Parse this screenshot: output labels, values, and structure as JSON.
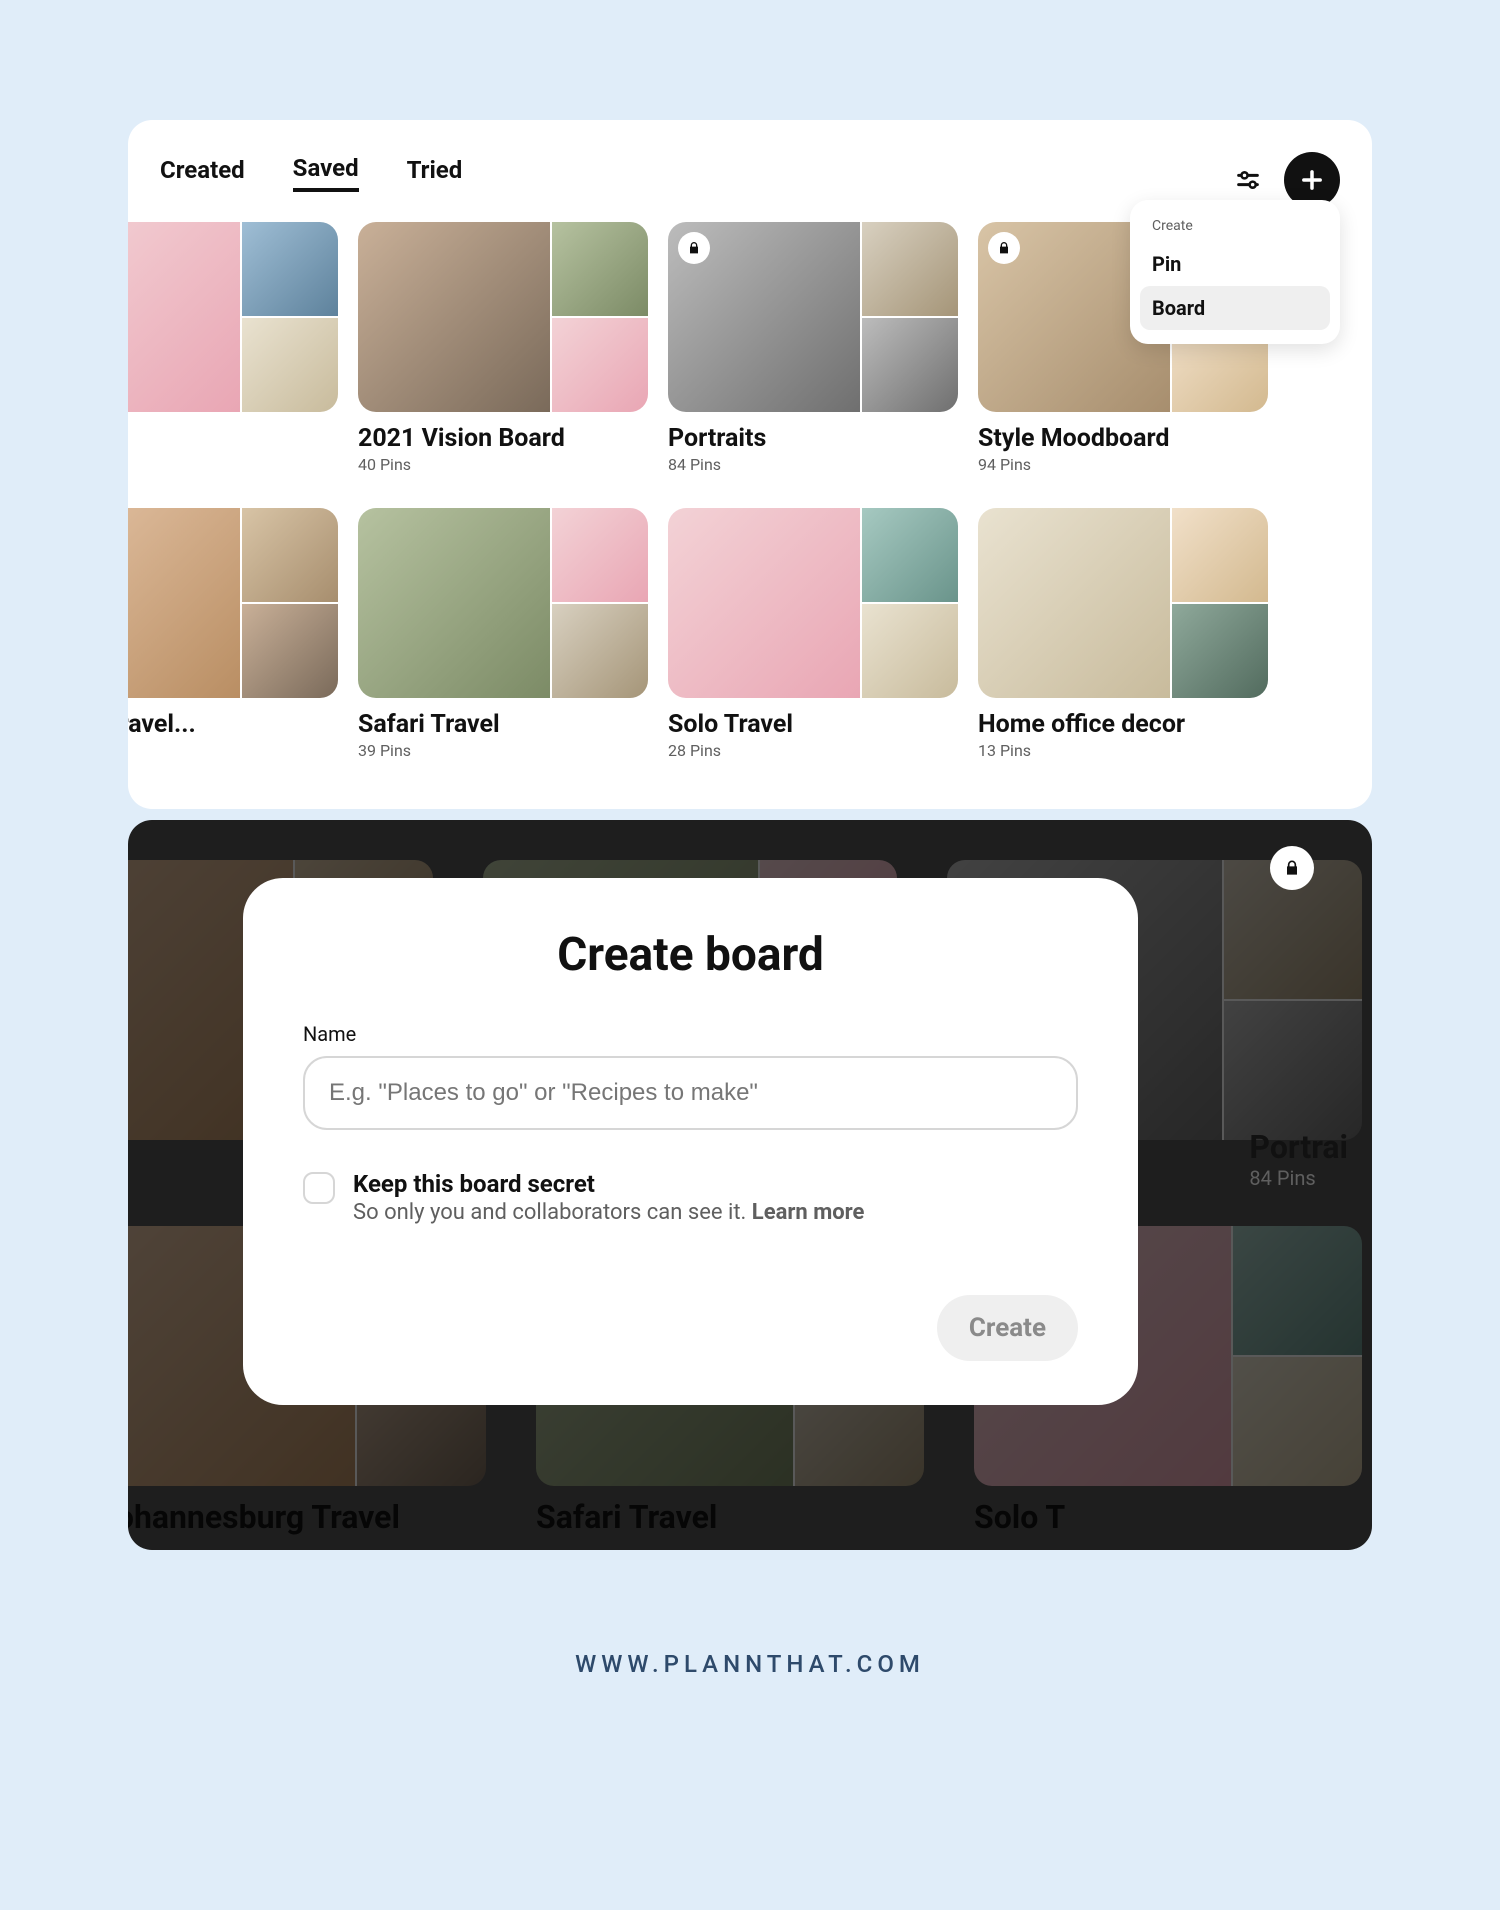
{
  "top": {
    "tabs": [
      "Created",
      "Saved",
      "Tried"
    ],
    "active_tab_index": 1,
    "popover": {
      "title": "Create",
      "items": [
        "Pin",
        "Board"
      ],
      "highlighted_index": 1
    },
    "boards_row1": [
      {
        "title": "",
        "meta": "",
        "locked": false
      },
      {
        "title": "2021 Vision Board",
        "meta": "40 Pins",
        "locked": false
      },
      {
        "title": "Portraits",
        "meta": "84 Pins",
        "locked": true
      },
      {
        "title": "Style Moodboard",
        "meta": "94 Pins",
        "locked": true
      }
    ],
    "boards_row2": [
      {
        "title": "burg Travel...",
        "meta": "",
        "locked": false
      },
      {
        "title": "Safari Travel",
        "meta": "39 Pins",
        "locked": false
      },
      {
        "title": "Solo Travel",
        "meta": "28 Pins",
        "locked": false
      },
      {
        "title": "Home office decor",
        "meta": "13 Pins",
        "locked": false
      }
    ]
  },
  "modal": {
    "title": "Create board",
    "name_label": "Name",
    "name_placeholder": "E.g. \"Places to go\" or \"Recipes to make\"",
    "secret_title": "Keep this board secret",
    "secret_desc": "So only you and collaborators can see it. ",
    "learn_more": "Learn more",
    "create_button": "Create"
  },
  "bottom": {
    "partial_title": "Portrai",
    "partial_meta": "84 Pins",
    "row_titles": [
      "Johannesburg Travel",
      "Safari Travel",
      "Solo T"
    ]
  },
  "footer": "WWW.PLANNTHAT.COM"
}
